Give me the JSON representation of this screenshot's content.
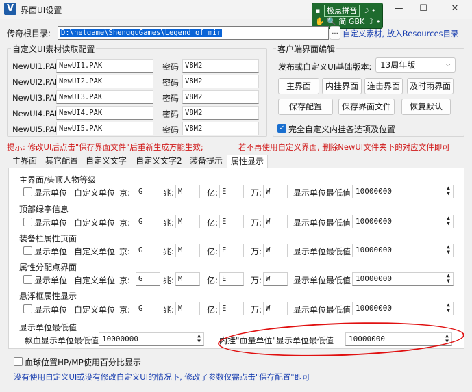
{
  "window": {
    "title": "界面UI设置",
    "app_icon": "V",
    "minimize": "—",
    "maximize": "☐",
    "close": "✕"
  },
  "ime": {
    "row1": "极点拼音",
    "row1_extra": "☽ •",
    "row2_hand": "✋",
    "row2_icon": "🔍",
    "row2_a": "简",
    "row2_b": "GBK",
    "row2_extra": "☽ •"
  },
  "path": {
    "label": "传奇根目录:",
    "value": "D:\\netgame\\ShengquGames\\Legend of mir",
    "browse": "...",
    "hint": "自定义素材, 放入Resources目录"
  },
  "material": {
    "title": "自定义UI素材读取配置",
    "pw_label": "密码",
    "rows": [
      {
        "label": "NewUI1.PAK",
        "value": "NewUI1.PAK",
        "pw": "V8M2"
      },
      {
        "label": "NewUI2.PAK",
        "value": "NewUI2.PAK",
        "pw": "V8M2"
      },
      {
        "label": "NewUI3.PAK",
        "value": "NewUI3.PAK",
        "pw": "V8M2"
      },
      {
        "label": "NewUI4.PAK",
        "value": "NewUI4.PAK",
        "pw": "V8M2"
      },
      {
        "label": "NewUI5.PAK",
        "value": "NewUI5.PAK",
        "pw": "V8M2"
      }
    ]
  },
  "client": {
    "title": "客户端界面编辑",
    "version_label": "发布或自定义UI基础版本:",
    "version_value": "13周年版",
    "buttons": [
      "主界面",
      "内挂界面",
      "连击界面",
      "及时雨界面",
      "保存配置",
      "保存界面文件",
      "恢复默认"
    ],
    "checkbox_label": "完全自定义内挂各选项及位置"
  },
  "tip": {
    "left": "提示: 修改UI后点击\"保存界面文件\"后重新生成方能生效;",
    "right": "若不再使用自定义界面, 删除NewUI文件夹下的对应文件即可"
  },
  "tabs": [
    "主界面",
    "其它配置",
    "自定义文字",
    "自定义文字2",
    "装备提示",
    "属性显示"
  ],
  "sections": [
    {
      "title": "主界面/头顶人物等级"
    },
    {
      "title": "顶部绿字信息"
    },
    {
      "title": "装备栏属性页面"
    },
    {
      "title": "属性分配点界面"
    },
    {
      "title": "悬浮框属性显示"
    }
  ],
  "row_fields": {
    "show_unit": "显示单位",
    "custom_unit": "自定义单位",
    "jing_label": "京:",
    "jing": "G",
    "zhao_label": "兆:",
    "zhao": "M",
    "yi_label": "亿:",
    "yi": "E",
    "wan_label": "万:",
    "wan": "W",
    "min_label": "显示单位最低值",
    "min_value": "10000000"
  },
  "min_section": {
    "title": "显示单位最低值",
    "float_label": "飘血显示单位最低值",
    "float_value": "10000000",
    "inner_label": "内挂\"血量单位\"显示单位最低值",
    "inner_value": "10000000"
  },
  "hp_checkbox": "血球位置HP/MP使用百分比显示",
  "footer": "没有使用自定义UI或没有修改自定义UI的情况下, 修改了参数仅需点击\"保存配置\"即可"
}
